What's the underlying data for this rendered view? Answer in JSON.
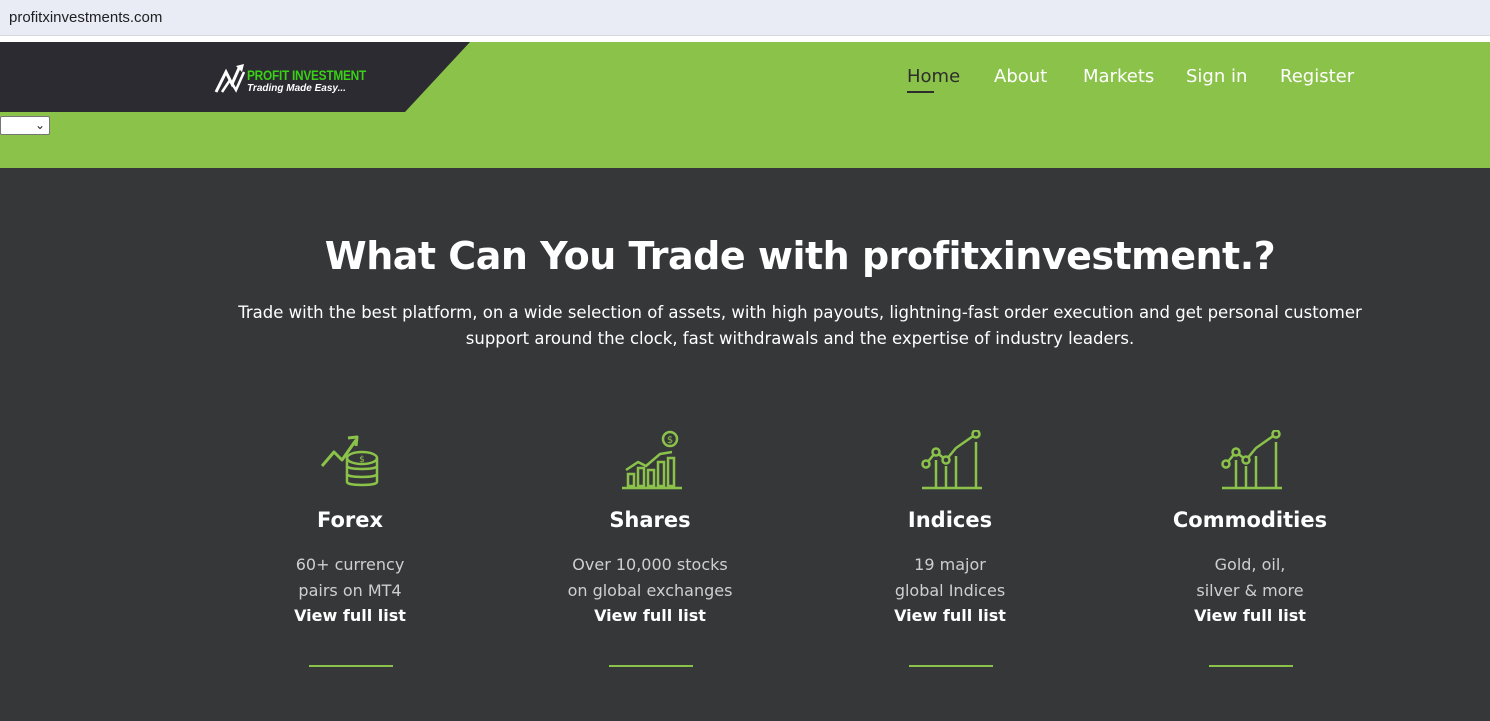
{
  "browser": {
    "url": "profitxinvestments.com"
  },
  "header": {
    "logo": {
      "brand": "PROFIT  INVESTMENT",
      "tagline": "Trading Made Easy..."
    },
    "language_select": {
      "value": ""
    },
    "nav": [
      {
        "label": "Home",
        "active": true
      },
      {
        "label": "About",
        "active": false
      },
      {
        "label": "Markets",
        "active": false
      },
      {
        "label": "Sign in",
        "active": false
      },
      {
        "label": "Register",
        "active": false
      }
    ]
  },
  "hero": {
    "title": "What Can You Trade with profitxinvestment.?",
    "subtitle_line1": "Trade with the best platform, on a wide selection of assets, with high payouts, lightning-fast order execution and get personal customer",
    "subtitle_line2": "support around the clock, fast withdrawals and the expertise of industry leaders."
  },
  "cards": [
    {
      "icon": "coins-growth-icon",
      "title": "Forex",
      "desc_line1": "60+ currency",
      "desc_line2": "pairs on MT4",
      "link": "View full list"
    },
    {
      "icon": "bar-chart-dollar-icon",
      "title": "Shares",
      "desc_line1": "Over 10,000 stocks",
      "desc_line2": "on global exchanges",
      "link": "View full list"
    },
    {
      "icon": "line-chart-icon",
      "title": "Indices",
      "desc_line1": "19 major",
      "desc_line2": "global Indices",
      "link": "View full list"
    },
    {
      "icon": "line-chart-icon",
      "title": "Commodities",
      "desc_line1": "Gold, oil,",
      "desc_line2": "silver & more",
      "link": "View full list"
    }
  ],
  "colors": {
    "accent_green": "#8bc34a",
    "brand_green": "#39d016",
    "dark_bg": "#363739",
    "logo_band": "#2b2b31"
  }
}
